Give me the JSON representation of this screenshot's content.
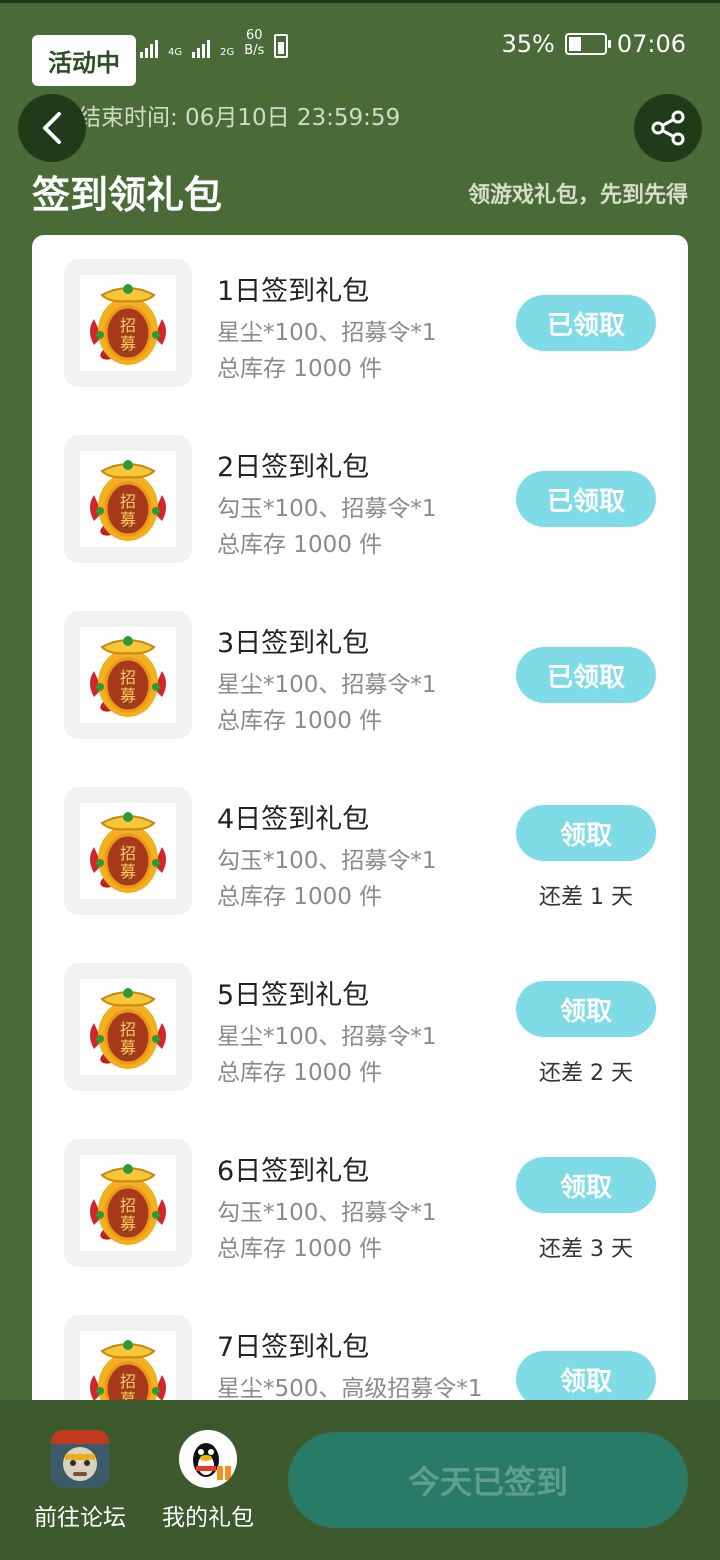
{
  "status": {
    "signal1": "4G",
    "signal2": "2G",
    "net_speed_value": "60",
    "net_speed_unit": "B/s",
    "battery": "35%",
    "time": "07:06"
  },
  "header": {
    "badge": "活动中",
    "end_time": "活动结束时间: 06月10日 23:59:59",
    "title": "签到领礼包",
    "subtitle": "领游戏礼包，先到先得"
  },
  "gifts": [
    {
      "name": "1日签到礼包",
      "items": "星尘*100、招募令*1",
      "stock": "总库存 1000 件",
      "button": "已领取",
      "remaining": ""
    },
    {
      "name": "2日签到礼包",
      "items": "勾玉*100、招募令*1",
      "stock": "总库存 1000 件",
      "button": "已领取",
      "remaining": ""
    },
    {
      "name": "3日签到礼包",
      "items": "星尘*100、招募令*1",
      "stock": "总库存 1000 件",
      "button": "已领取",
      "remaining": ""
    },
    {
      "name": "4日签到礼包",
      "items": "勾玉*100、招募令*1",
      "stock": "总库存 1000 件",
      "button": "领取",
      "remaining": "还差 1 天"
    },
    {
      "name": "5日签到礼包",
      "items": "星尘*100、招募令*1",
      "stock": "总库存 1000 件",
      "button": "领取",
      "remaining": "还差 2 天"
    },
    {
      "name": "6日签到礼包",
      "items": "勾玉*100、招募令*1",
      "stock": "总库存 1000 件",
      "button": "领取",
      "remaining": "还差 3 天"
    },
    {
      "name": "7日签到礼包",
      "items": "星尘*500、高级招募令*1",
      "stock": "",
      "button": "领取",
      "remaining": ""
    }
  ],
  "token_glyphs": {
    "top": "招",
    "bottom": "募"
  },
  "bottom_nav": {
    "forum": "前往论坛",
    "my_gifts": "我的礼包",
    "signed": "今天已签到"
  },
  "colors": {
    "background": "#4a6a37",
    "button": "#7fdbe6",
    "signed_button": "#2a7a68"
  }
}
